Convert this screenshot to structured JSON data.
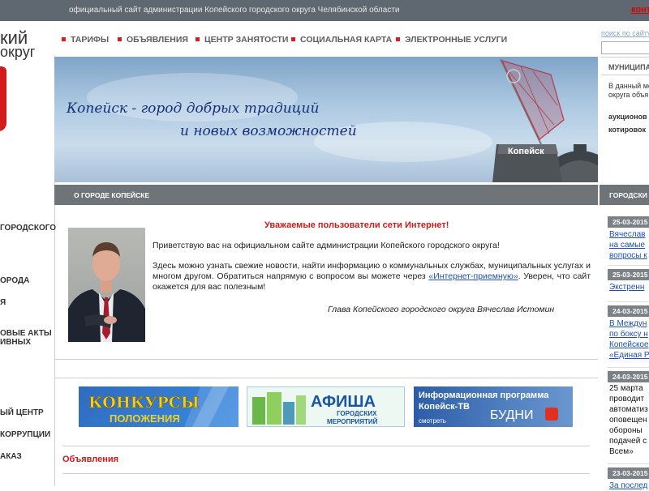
{
  "topbar": {
    "site_title": "официальный сайт администрации Копейского городского округа Челябинской области",
    "login_link": "конт"
  },
  "logo": {
    "line1": "кий",
    "line2": "округ"
  },
  "nav": {
    "items": [
      {
        "label": "ТАРИФЫ"
      },
      {
        "label": "ОБЪЯВЛЕНИЯ"
      },
      {
        "label": "ЦЕНТР ЗАНЯТОСТИ"
      },
      {
        "label": "СОЦИАЛЬНАЯ КАРТА"
      },
      {
        "label": "ЭЛЕКТРОННЫЕ УСЛУГИ"
      }
    ]
  },
  "search": {
    "label": "поиск по сайту"
  },
  "banner": {
    "slogan_line1": "Копейск - город добрых традиций",
    "slogan_line2": "и новых возможностей",
    "monument_text": "Копейск"
  },
  "subheader": {
    "title": "О ГОРОДЕ КОПЕЙСКЕ"
  },
  "left_menu": {
    "items": [
      {
        "label": "ГОРОДСКОГО"
      },
      {
        "label": "ОРОДА"
      },
      {
        "label": "Я"
      },
      {
        "label": "ОВЫЕ АКТЫ"
      },
      {
        "label": "ИВНЫХ"
      },
      {
        "label": "ЫЙ ЦЕНТР"
      },
      {
        "label": "КОРРУПЦИИ"
      },
      {
        "label": "АКАЗ"
      }
    ]
  },
  "welcome": {
    "heading": "Уважаемые пользователи сети Интернет!",
    "p1": "Приветствую вас на официальном сайте администрации Копейского городского округа!",
    "p2_start": "Здесь можно узнать свежие новости, найти информацию о коммунальных службах, муниципальных услугах и многом другом. Обратиться напрямую с вопросом вы можете через ",
    "p2_link": "«Интернет-приемную»",
    "p2_end": ". Уверен, что сайт окажется для вас полезным!",
    "signature": "Глава Копейского городского округа Вячеслав Истомин"
  },
  "promo": {
    "b1_title": "КОНКУРСЫ",
    "b1_sub": "ПОЛОЖЕНИЯ",
    "b2_title": "АФИША",
    "b2_sub1": "ГОРОДСКИХ",
    "b2_sub2": "МЕРОПРИЯТИЙ",
    "b3_title1": "Информационная программа",
    "b3_title2": "Копейск-ТВ",
    "b3_watch": "смотреть",
    "b3_news": "БУДНИ"
  },
  "ads": {
    "title": "Объявления"
  },
  "right": {
    "municipal_title": "МУНИЦИПАЛ",
    "municipal_text1": "В данный мо",
    "municipal_text2": "округа объя",
    "link1": "аукционов",
    "link2": "котировок",
    "city_news_title": "ГОРОДСКИ",
    "news": [
      {
        "date": "25-03-2015",
        "lines": [
          "Вячеслав",
          "на самые",
          "вопросы к"
        ],
        "link": true
      },
      {
        "date": "25-03-2015",
        "lines": [
          "Экстренн"
        ],
        "link": true
      },
      {
        "date": "24-03-2015",
        "lines": [
          "В Междун",
          "по боксу н",
          "Копейское",
          "«Единая Р"
        ],
        "link": true
      },
      {
        "date": "24-03-2015",
        "lines": [
          "25 марта",
          "проводит",
          "автоматиз",
          "оповещен",
          "обороны",
          "подачей с",
          "Всем»"
        ],
        "link": false
      },
      {
        "date": "23-03-2015",
        "lines": [
          "За послед"
        ],
        "link": true
      }
    ]
  },
  "colors": {
    "accent_red": "#d42020",
    "link_blue": "#1d4fb0",
    "bar_gray": "#6f7479"
  }
}
